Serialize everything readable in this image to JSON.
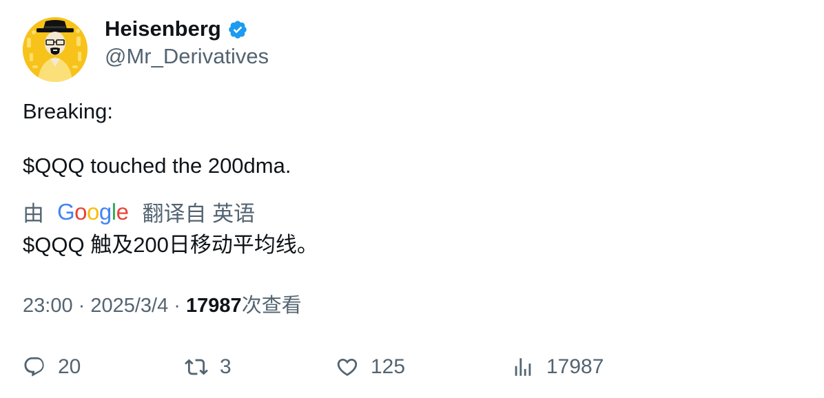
{
  "author": {
    "display_name": "Heisenberg",
    "handle": "@Mr_Derivatives",
    "verified": true,
    "avatar_icon": "heisenberg-avatar",
    "verified_color": "#1d9bf0"
  },
  "tweet": {
    "lines": [
      "Breaking:",
      "$QQQ touched the 200dma."
    ]
  },
  "translation": {
    "prefix": "由",
    "google_letters": [
      "G",
      "o",
      "o",
      "g",
      "l",
      "e"
    ],
    "suffix": "翻译自 英语",
    "text": "$QQQ 触及200日移动平均线。"
  },
  "meta": {
    "time": "23:00",
    "separator": " · ",
    "date": "2025/3/4",
    "views_count": "17987",
    "views_label": "次查看"
  },
  "actions": {
    "reply": {
      "icon": "reply-icon",
      "count": "20"
    },
    "retweet": {
      "icon": "retweet-icon",
      "count": "3"
    },
    "like": {
      "icon": "heart-icon",
      "count": "125"
    },
    "views": {
      "icon": "analytics-icon",
      "count": "17987"
    }
  },
  "colors": {
    "text_primary": "#0f1419",
    "text_secondary": "#536471",
    "avatar_bg": "#f5c518"
  }
}
